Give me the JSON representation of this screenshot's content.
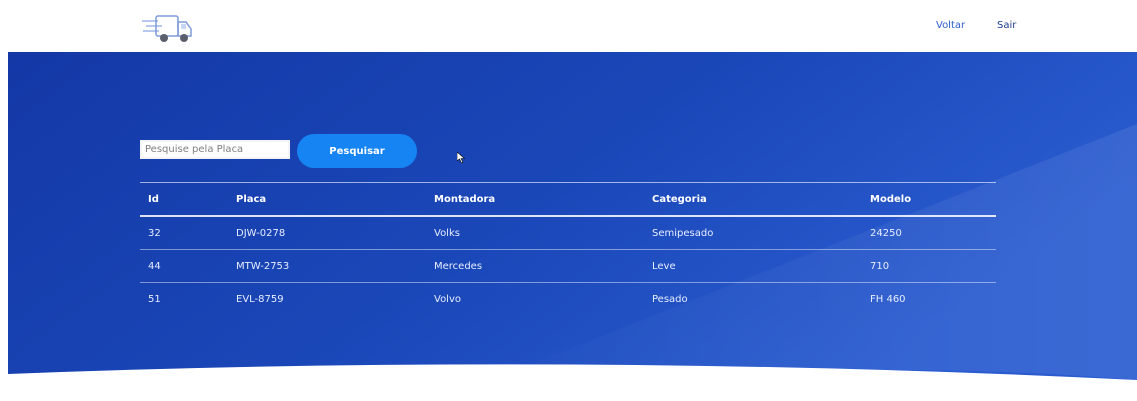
{
  "header": {
    "nav": {
      "voltar": "Voltar",
      "sair": "Sair"
    }
  },
  "search": {
    "placeholder": "Pesquise pela Placa",
    "value": "",
    "button_label": "Pesquisar"
  },
  "table": {
    "columns": {
      "id": "Id",
      "placa": "Placa",
      "montadora": "Montadora",
      "categoria": "Categoria",
      "modelo": "Modelo"
    },
    "rows": [
      {
        "id": "32",
        "placa": "DJW-0278",
        "montadora": "Volks",
        "categoria": "Semipesado",
        "modelo": "24250"
      },
      {
        "id": "44",
        "placa": "MTW-2753",
        "montadora": "Mercedes",
        "categoria": "Leve",
        "modelo": "710"
      },
      {
        "id": "51",
        "placa": "EVL-8759",
        "montadora": "Volvo",
        "categoria": "Pesado",
        "modelo": "FH 460"
      }
    ]
  },
  "icons": {
    "logo": "truck-logo-icon",
    "cursor": "mouse-cursor-icon"
  },
  "colors": {
    "hero_dark": "#1438a6",
    "hero_light": "#2e5fd4",
    "button": "#1684f2",
    "nav_link": "#2f5fd0",
    "text_on_blue": "#ffffff"
  }
}
